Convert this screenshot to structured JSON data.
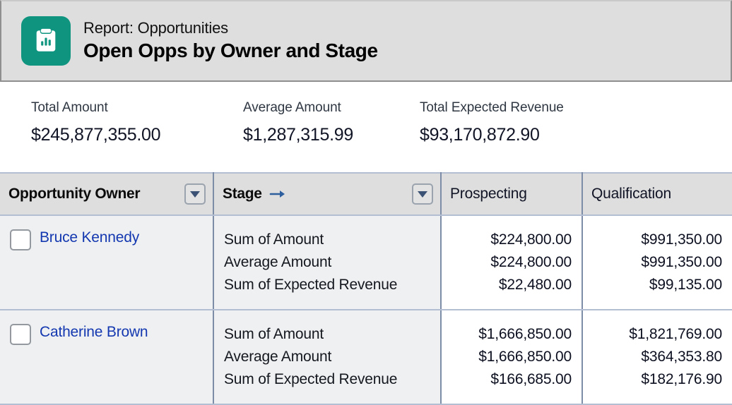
{
  "header": {
    "icon_name": "report-clipboard-chart-icon",
    "icon_color": "#0f9480",
    "kicker": "Report: Opportunities",
    "title": "Open Opps by Owner and Stage"
  },
  "metrics": [
    {
      "label": "Total Amount",
      "value": "$245,877,355.00"
    },
    {
      "label": "Average Amount",
      "value": "$1,287,315.99"
    },
    {
      "label": "Total Expected Revenue",
      "value": "$93,170,872.90"
    }
  ],
  "table": {
    "group_headers": [
      {
        "label": "Opportunity Owner",
        "has_menu": true,
        "has_sort_arrow": false
      },
      {
        "label": "Stage",
        "has_menu": true,
        "has_sort_arrow": true
      }
    ],
    "column_headers": [
      "Prospecting",
      "Qualification"
    ],
    "measure_labels": [
      "Sum of Amount",
      "Average Amount",
      "Sum of Expected Revenue"
    ],
    "rows": [
      {
        "owner": "Bruce Kennedy",
        "checkbox_checked": false,
        "measures": [
          "Sum of Amount",
          "Average Amount",
          "Sum of Expected Revenue"
        ],
        "prospecting": [
          "$224,800.00",
          "$224,800.00",
          "$22,480.00"
        ],
        "qualification": [
          "$991,350.00",
          "$991,350.00",
          "$99,135.00"
        ]
      },
      {
        "owner": "Catherine Brown",
        "checkbox_checked": false,
        "measures": [
          "Sum of Amount",
          "Average Amount",
          "Sum of Expected Revenue"
        ],
        "prospecting": [
          "$1,666,850.00",
          "$1,666,850.00",
          "$166,685.00"
        ],
        "qualification": [
          "$1,821,769.00",
          "$364,353.80",
          "$182,176.90"
        ]
      }
    ]
  },
  "colors": {
    "link": "#1438b0",
    "header_band": "#dedede",
    "grid_border": "#7d8da8",
    "group_cell_bg": "#eef0f2"
  }
}
